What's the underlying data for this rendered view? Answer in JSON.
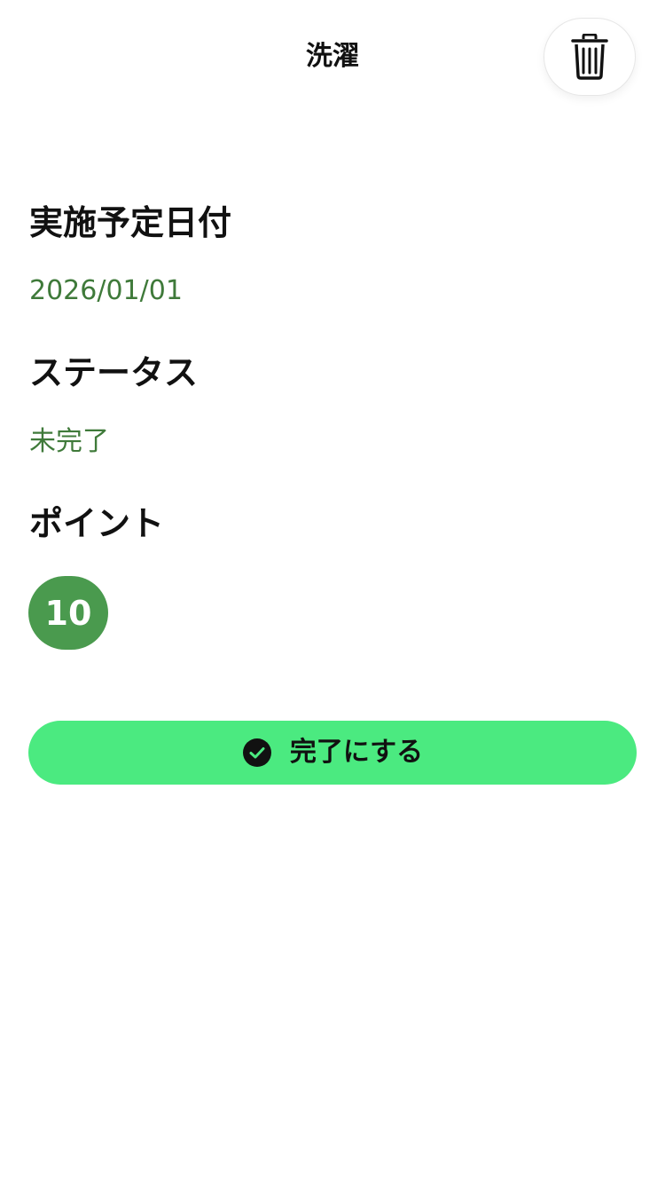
{
  "header": {
    "title": "洗濯",
    "delete_icon": "trash-icon"
  },
  "details": {
    "date_label": "実施予定日付",
    "date_value": "2026/01/01",
    "status_label": "ステータス",
    "status_value": "未完了",
    "points_label": "ポイント",
    "points_value": "10"
  },
  "actions": {
    "complete_label": "完了にする",
    "complete_icon": "check-circle-icon"
  },
  "colors": {
    "value_text": "#3f7a3a",
    "badge_bg": "#4a9a4e",
    "button_bg": "#4bea80",
    "icon_dark": "#111111"
  }
}
